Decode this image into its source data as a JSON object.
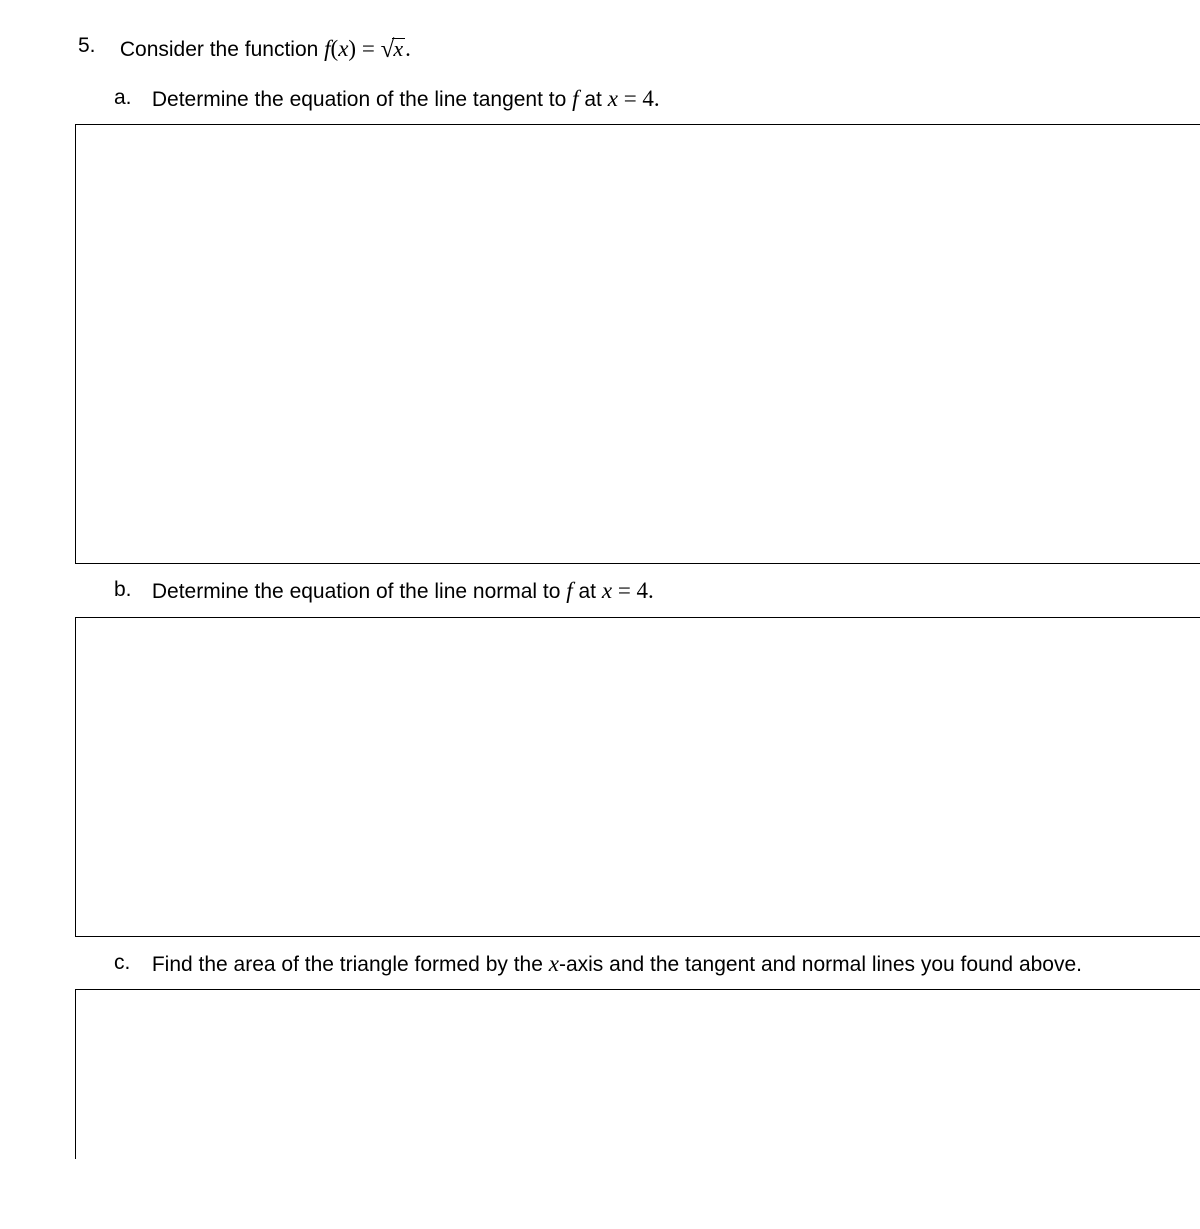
{
  "question": {
    "number": "5.",
    "stem_prefix": "Consider the function ",
    "func_lhs_f": "f",
    "func_lhs_paren_open": "(",
    "func_lhs_x": "x",
    "func_lhs_paren_close": ")",
    "equals": " = ",
    "sqrt_radicand": "x",
    "period": "."
  },
  "parts": {
    "a": {
      "letter": "a.",
      "text_before": "Determine the equation of the line tangent to ",
      "f": "f",
      "at_text": " at ",
      "x": "x",
      "eq": " = 4.",
      "answer": ""
    },
    "b": {
      "letter": "b.",
      "text_before": "Determine the equation of the line normal to ",
      "f": "f",
      "at_text": " at ",
      "x": "x",
      "eq": " = 4.",
      "answer": ""
    },
    "c": {
      "letter": "c.",
      "text_before": "Find the area of the triangle formed by the ",
      "x": "x",
      "text_after": "-axis and the tangent and normal lines you found above.",
      "answer": ""
    }
  }
}
